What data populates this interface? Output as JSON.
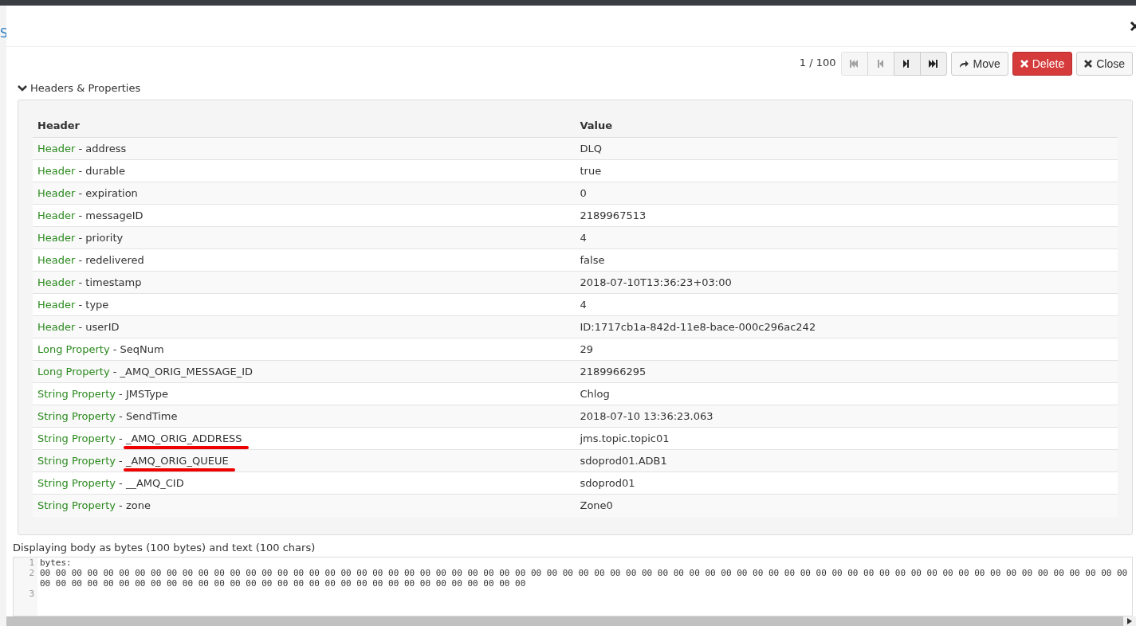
{
  "background": {
    "link_fragment": "S"
  },
  "toolbar": {
    "counter": "1 / 100",
    "nav_buttons": [
      {
        "kind": "first",
        "disabled": true
      },
      {
        "kind": "prev",
        "disabled": true
      },
      {
        "kind": "next",
        "disabled": false
      },
      {
        "kind": "last",
        "disabled": false
      }
    ],
    "buttons": [
      {
        "kind": "move",
        "label": "Move"
      },
      {
        "kind": "delete",
        "label": "Delete"
      },
      {
        "kind": "close",
        "label": "Close"
      }
    ]
  },
  "section": {
    "title": "Headers & Properties",
    "expanded": true
  },
  "table": {
    "columns": [
      "Header",
      "Value"
    ],
    "rows": [
      {
        "type": "Header",
        "separator": "-",
        "name": "address",
        "value": "DLQ",
        "annotated": false
      },
      {
        "type": "Header",
        "separator": "-",
        "name": "durable",
        "value": "true",
        "annotated": false
      },
      {
        "type": "Header",
        "separator": "-",
        "name": "expiration",
        "value": "0",
        "annotated": false
      },
      {
        "type": "Header",
        "separator": "-",
        "name": "messageID",
        "value": "2189967513",
        "annotated": false
      },
      {
        "type": "Header",
        "separator": "-",
        "name": "priority",
        "value": "4",
        "annotated": false
      },
      {
        "type": "Header",
        "separator": "-",
        "name": "redelivered",
        "value": "false",
        "annotated": false
      },
      {
        "type": "Header",
        "separator": "-",
        "name": "timestamp",
        "value": "2018-07-10T13:36:23+03:00",
        "annotated": false
      },
      {
        "type": "Header",
        "separator": "-",
        "name": "type",
        "value": "4",
        "annotated": false
      },
      {
        "type": "Header",
        "separator": "-",
        "name": "userID",
        "value": "ID:1717cb1a-842d-11e8-bace-000c296ac242",
        "annotated": false
      },
      {
        "type": "Long Property",
        "separator": "-",
        "name": "SeqNum",
        "value": "29",
        "annotated": false
      },
      {
        "type": "Long Property",
        "separator": "-",
        "name": "_AMQ_ORIG_MESSAGE_ID",
        "value": "2189966295",
        "annotated": false
      },
      {
        "type": "String Property",
        "separator": "-",
        "name": "JMSType",
        "value": "Chlog",
        "annotated": false
      },
      {
        "type": "String Property",
        "separator": "-",
        "name": "SendTime",
        "value": "2018-07-10 13:36:23.063",
        "annotated": false
      },
      {
        "type": "String Property",
        "separator": "-",
        "name": "_AMQ_ORIG_ADDRESS",
        "value": "jms.topic.topic01",
        "annotated": true
      },
      {
        "type": "String Property",
        "separator": "-",
        "name": "_AMQ_ORIG_QUEUE",
        "value": "sdoprod01.ADB1",
        "annotated": true
      },
      {
        "type": "String Property",
        "separator": "-",
        "name": "__AMQ_CID",
        "value": "sdoprod01",
        "annotated": false
      },
      {
        "type": "String Property",
        "separator": "-",
        "name": "zone",
        "value": "Zone0",
        "annotated": false
      }
    ]
  },
  "body": {
    "caption": "Displaying body as bytes (100 bytes) and text (100 chars)",
    "lines": [
      {
        "number": "1",
        "text": "bytes:"
      },
      {
        "number": "2",
        "text": "00 00 00 00 00 00 00 00 00 00 00 00 00 00 00 00 00 00 00 00 00 00 00 00 00 00 00 00 00 00 00 00 00 00 00 00 00 00 00 00 00 00 00 00 00 00 00 00 00 00 00 00 00 00 00 00 00 00 00 00 00 00 00 00 00 00 00 00 00 00 00 00 00 00 00 00 00 00 00 00 00 00 00 00 00 00 00 00 00 00 00 00 00 00 00 00 00 00 00 00"
      },
      {
        "number": "3"
      }
    ]
  }
}
